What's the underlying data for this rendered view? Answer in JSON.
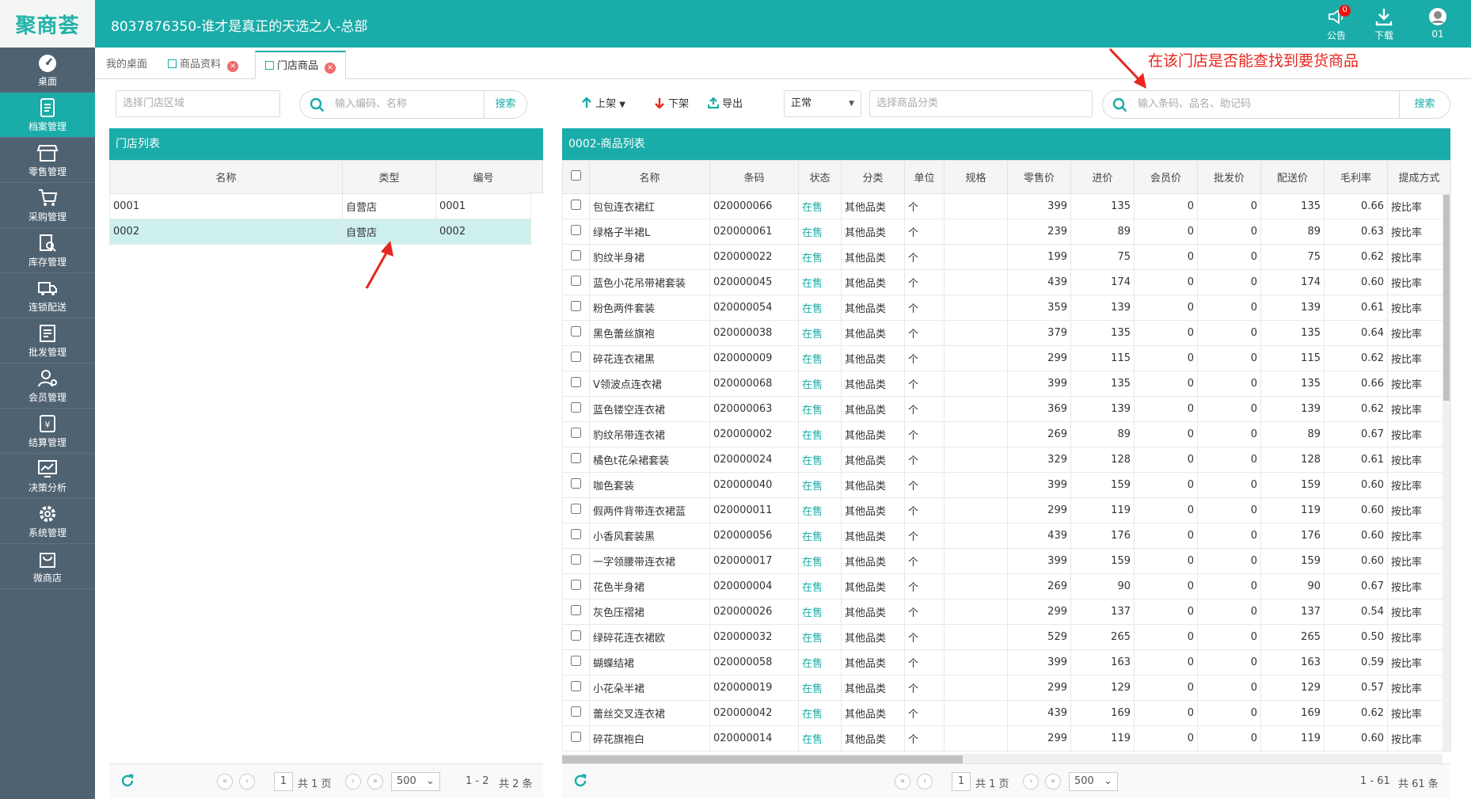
{
  "app": {
    "logo": "聚商荟",
    "title": "8037876350-谁才是真正的天选之人-总部",
    "notice_label": "公告",
    "notice_count": "0",
    "download_label": "下载",
    "user_label": "01"
  },
  "sidebar": {
    "items": [
      {
        "label": "桌面",
        "icon": "dashboard-icon"
      },
      {
        "label": "档案管理",
        "icon": "archive-icon"
      },
      {
        "label": "零售管理",
        "icon": "store-icon"
      },
      {
        "label": "采购管理",
        "icon": "cart-icon"
      },
      {
        "label": "库存管理",
        "icon": "inventory-icon"
      },
      {
        "label": "连锁配送",
        "icon": "truck-icon"
      },
      {
        "label": "批发管理",
        "icon": "wholesale-icon"
      },
      {
        "label": "会员管理",
        "icon": "member-icon"
      },
      {
        "label": "结算管理",
        "icon": "settlement-icon"
      },
      {
        "label": "决策分析",
        "icon": "analysis-icon"
      },
      {
        "label": "系统管理",
        "icon": "gear-icon"
      },
      {
        "label": "微商店",
        "icon": "shop-bag-icon"
      }
    ],
    "active_index": 1
  },
  "tabs": [
    {
      "label": "我的桌面"
    },
    {
      "label": "商品资料"
    },
    {
      "label": "门店商品"
    }
  ],
  "left": {
    "region_placeholder": "选择门店区域",
    "search_placeholder": "输入编码、名称",
    "search_button": "搜索",
    "panel_title": "门店列表",
    "columns": [
      "名称",
      "类型",
      "编号"
    ],
    "rows": [
      {
        "name": "0001",
        "type": "自营店",
        "code": "0001"
      },
      {
        "name": "0002",
        "type": "自营店",
        "code": "0002"
      }
    ],
    "selected_row": 1,
    "pager": {
      "page": "1",
      "total_pages": "共 1 页",
      "page_size": "500",
      "range": "1 - 2",
      "total": "共 2 条"
    }
  },
  "right": {
    "toolbar": {
      "up": "上架",
      "down": "下架",
      "export": "导出"
    },
    "status_select": "正常",
    "category_placeholder": "选择商品分类",
    "search_placeholder": "输入条码、品名、助记码",
    "search_button": "搜索",
    "panel_title": "0002-商品列表",
    "columns": [
      "名称",
      "条码",
      "状态",
      "分类",
      "单位",
      "规格",
      "零售价",
      "进价",
      "会员价",
      "批发价",
      "配送价",
      "毛利率",
      "提成方式"
    ],
    "rows": [
      [
        "包包连衣裙红",
        "020000066",
        "在售",
        "其他品类",
        "个",
        "",
        "399",
        "135",
        "0",
        "0",
        "135",
        "0.66",
        "按比率"
      ],
      [
        "绿格子半裙L",
        "020000061",
        "在售",
        "其他品类",
        "个",
        "",
        "239",
        "89",
        "0",
        "0",
        "89",
        "0.63",
        "按比率"
      ],
      [
        "豹纹半身裙",
        "020000022",
        "在售",
        "其他品类",
        "个",
        "",
        "199",
        "75",
        "0",
        "0",
        "75",
        "0.62",
        "按比率"
      ],
      [
        "蓝色小花吊带裙套装",
        "020000045",
        "在售",
        "其他品类",
        "个",
        "",
        "439",
        "174",
        "0",
        "0",
        "174",
        "0.60",
        "按比率"
      ],
      [
        "粉色两件套装",
        "020000054",
        "在售",
        "其他品类",
        "个",
        "",
        "359",
        "139",
        "0",
        "0",
        "139",
        "0.61",
        "按比率"
      ],
      [
        "黑色蕾丝旗袍",
        "020000038",
        "在售",
        "其他品类",
        "个",
        "",
        "379",
        "135",
        "0",
        "0",
        "135",
        "0.64",
        "按比率"
      ],
      [
        "碎花连衣裙黑",
        "020000009",
        "在售",
        "其他品类",
        "个",
        "",
        "299",
        "115",
        "0",
        "0",
        "115",
        "0.62",
        "按比率"
      ],
      [
        "V领波点连衣裙",
        "020000068",
        "在售",
        "其他品类",
        "个",
        "",
        "399",
        "135",
        "0",
        "0",
        "135",
        "0.66",
        "按比率"
      ],
      [
        "蓝色镂空连衣裙",
        "020000063",
        "在售",
        "其他品类",
        "个",
        "",
        "369",
        "139",
        "0",
        "0",
        "139",
        "0.62",
        "按比率"
      ],
      [
        "豹纹吊带连衣裙",
        "020000002",
        "在售",
        "其他品类",
        "个",
        "",
        "269",
        "89",
        "0",
        "0",
        "89",
        "0.67",
        "按比率"
      ],
      [
        "橘色t花朵裙套装",
        "020000024",
        "在售",
        "其他品类",
        "个",
        "",
        "329",
        "128",
        "0",
        "0",
        "128",
        "0.61",
        "按比率"
      ],
      [
        "咖色套装",
        "020000040",
        "在售",
        "其他品类",
        "个",
        "",
        "399",
        "159",
        "0",
        "0",
        "159",
        "0.60",
        "按比率"
      ],
      [
        "假两件背带连衣裙蓝",
        "020000011",
        "在售",
        "其他品类",
        "个",
        "",
        "299",
        "119",
        "0",
        "0",
        "119",
        "0.60",
        "按比率"
      ],
      [
        "小香风套装黑",
        "020000056",
        "在售",
        "其他品类",
        "个",
        "",
        "439",
        "176",
        "0",
        "0",
        "176",
        "0.60",
        "按比率"
      ],
      [
        "一字领腰带连衣裙",
        "020000017",
        "在售",
        "其他品类",
        "个",
        "",
        "399",
        "159",
        "0",
        "0",
        "159",
        "0.60",
        "按比率"
      ],
      [
        "花色半身裙",
        "020000004",
        "在售",
        "其他品类",
        "个",
        "",
        "269",
        "90",
        "0",
        "0",
        "90",
        "0.67",
        "按比率"
      ],
      [
        "灰色压褶裙",
        "020000026",
        "在售",
        "其他品类",
        "个",
        "",
        "299",
        "137",
        "0",
        "0",
        "137",
        "0.54",
        "按比率"
      ],
      [
        "绿碎花连衣裙欧",
        "020000032",
        "在售",
        "其他品类",
        "个",
        "",
        "529",
        "265",
        "0",
        "0",
        "265",
        "0.50",
        "按比率"
      ],
      [
        "蝴蝶结裙",
        "020000058",
        "在售",
        "其他品类",
        "个",
        "",
        "399",
        "163",
        "0",
        "0",
        "163",
        "0.59",
        "按比率"
      ],
      [
        "小花朵半裙",
        "020000019",
        "在售",
        "其他品类",
        "个",
        "",
        "299",
        "129",
        "0",
        "0",
        "129",
        "0.57",
        "按比率"
      ],
      [
        "蕾丝交叉连衣裙",
        "020000042",
        "在售",
        "其他品类",
        "个",
        "",
        "439",
        "169",
        "0",
        "0",
        "169",
        "0.62",
        "按比率"
      ],
      [
        "碎花旗袍白",
        "020000014",
        "在售",
        "其他品类",
        "个",
        "",
        "299",
        "119",
        "0",
        "0",
        "119",
        "0.60",
        "按比率"
      ]
    ],
    "pager": {
      "page": "1",
      "total_pages": "共 1 页",
      "page_size": "500",
      "range": "1 - 61",
      "total": "共 61 条"
    }
  },
  "annotation": {
    "text": "在该门店是否能查找到要货商品"
  },
  "colors": {
    "accent": "#1aaca8",
    "sidebar": "#4f6272",
    "annotation": "#e8261d",
    "selected_row": "#cdf0ee"
  }
}
